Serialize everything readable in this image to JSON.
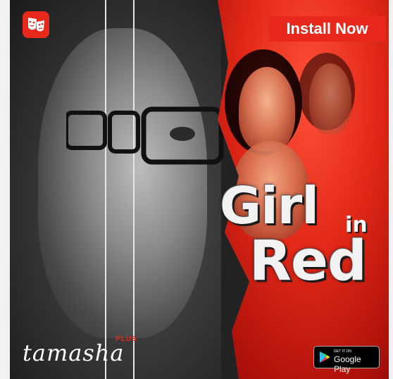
{
  "ad": {
    "install_label": "Install Now",
    "title_line1": "Girl",
    "title_small": "in",
    "title_line2": "Red",
    "brand_name": "tamasha",
    "brand_plus": "PLUS",
    "badge_small": "GET IT ON",
    "badge_large": "Google Play"
  },
  "colors": {
    "accent_red": "#e8281a",
    "background": "#f1f1f1"
  },
  "icons": {
    "app_logo": "theatre-masks-icon",
    "store": "google-play-icon"
  }
}
